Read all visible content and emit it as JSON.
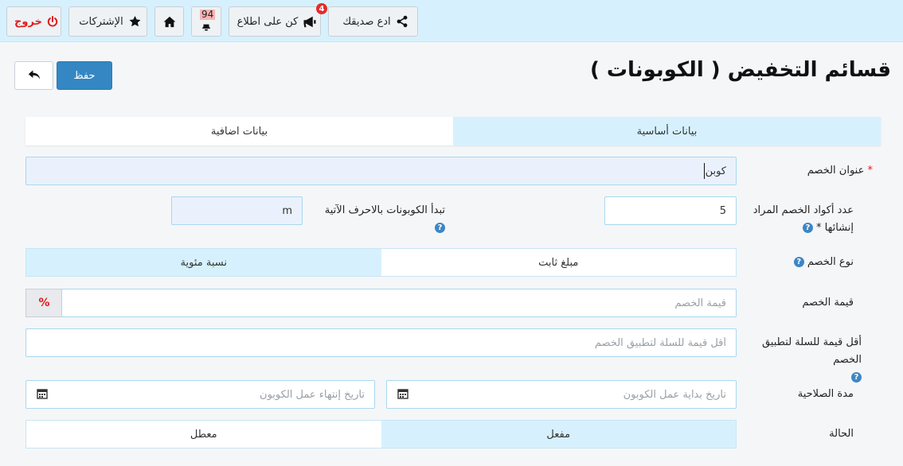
{
  "topbar": {
    "logout": "خروج",
    "subscriptions": "الإشتركات",
    "notifications_count": "94",
    "stay_informed": "كن على اطلاع",
    "stay_informed_badge": "4",
    "invite_friend": "ادع صديقك"
  },
  "header": {
    "title": "قسائم التخفيض ( الكوبونات )",
    "save_label": "حفظ"
  },
  "tabs": [
    {
      "label": "بيانات أساسية"
    },
    {
      "label": "بيانات اضافية"
    }
  ],
  "form": {
    "title": {
      "label": "عنوان الخصم",
      "required_mark": "*",
      "value": "كوبن"
    },
    "codes_count": {
      "label": "عدد أكواد الخصم المراد إنشائها",
      "required_mark": "*",
      "value": "5"
    },
    "prefix": {
      "label": "تبدأ الكوبونات بالاحرف الآتية",
      "value": "m"
    },
    "discount_type": {
      "label": "نوع الخصم",
      "options": [
        "مبلغ ثابت",
        "نسبة مئوية"
      ],
      "selected": "مبلغ ثابت"
    },
    "discount_value": {
      "label": "قيمة الخصم",
      "placeholder": "قيمة الخصم",
      "addon": "%"
    },
    "min_cart": {
      "label": "أقل قيمة للسلة لتطبيق الخصم",
      "placeholder": "أقل قيمة للسلة لتطبيق الخصم"
    },
    "validity": {
      "label": "مدة الصلاحية",
      "start_placeholder": "تاريخ بداية عمل الكوبون",
      "end_placeholder": "تاريخ إنتهاء عمل الكوبون"
    },
    "status": {
      "label": "الحالة",
      "options": [
        "مفعل",
        "معطل"
      ],
      "selected": "معطل"
    }
  },
  "icons": {
    "help": "?",
    "colors": {
      "accent": "#3487c2",
      "danger": "#e01b1b",
      "light_blue": "#d6f1fd"
    }
  }
}
